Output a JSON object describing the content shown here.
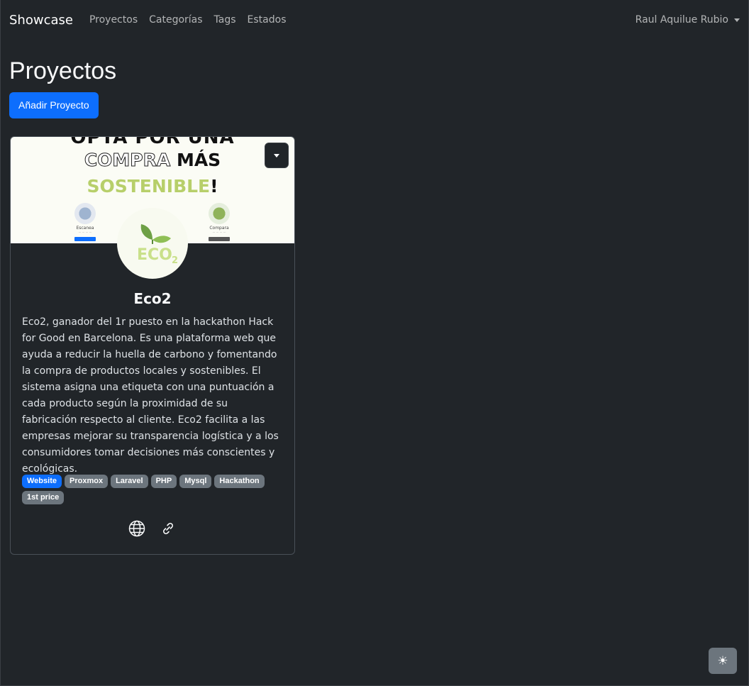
{
  "navbar": {
    "brand": "Showcase",
    "links": [
      "Proyectos",
      "Categorías",
      "Tags",
      "Estados"
    ],
    "user": "Raul Aquilue Rubio"
  },
  "page": {
    "title": "Proyectos",
    "add_button": "Añadir Proyecto"
  },
  "card": {
    "banner": {
      "line1": "OPTA POR UNA",
      "line2_outline": "COMPRA",
      "line2_bold": "MÁS",
      "line3": "SOSTENIBLE",
      "line3_excl": "!",
      "feature_left": "Escanea",
      "feature_right": "Compara"
    },
    "logo_text": "ECO",
    "logo_sub": "2",
    "title": "Eco2",
    "description": "Eco2, ganador del 1r puesto en la hackathon Hack for Good en Barcelona. Es una plataforma web que ayuda a reducir la huella de carbono y fomentando la compra de productos locales y sostenibles. El sistema asigna una etiqueta con una puntuación a cada producto según la proximidad de su fabricación respecto al cliente. Eco2 facilita a las empresas mejorar su transparencia logística y a los consumidores tomar decisiones más conscientes y ecológicas.",
    "badges": [
      {
        "label": "Website",
        "variant": "primary"
      },
      {
        "label": "Proxmox",
        "variant": "secondary"
      },
      {
        "label": "Laravel",
        "variant": "secondary"
      },
      {
        "label": "PHP",
        "variant": "secondary"
      },
      {
        "label": "Mysql",
        "variant": "secondary"
      },
      {
        "label": "Hackathon",
        "variant": "secondary"
      },
      {
        "label": "1st price",
        "variant": "secondary"
      }
    ],
    "icons": [
      "globe-icon",
      "link-icon"
    ]
  },
  "theme_toggle_icon": "☀",
  "colors": {
    "background": "#212529",
    "primary": "#0d6efd",
    "secondary": "#6c757d",
    "eco_green": "#b7cf6a"
  }
}
